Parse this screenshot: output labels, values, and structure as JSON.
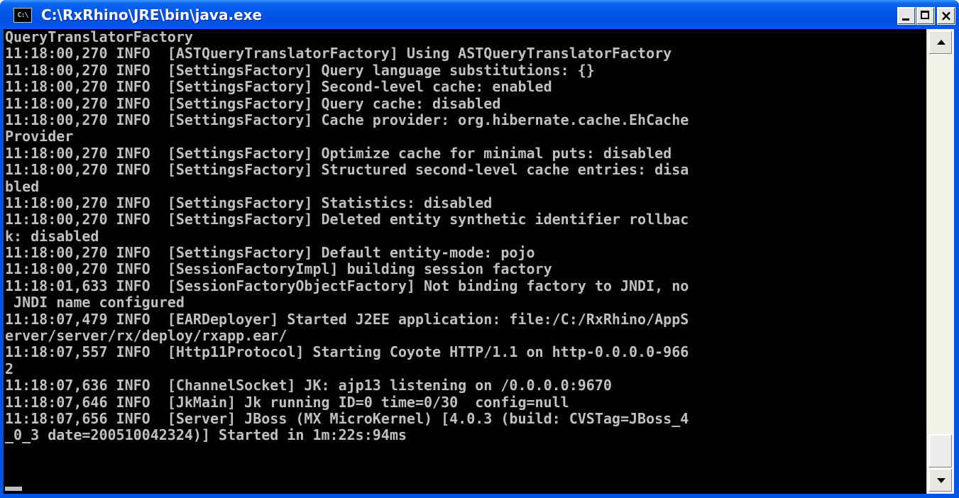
{
  "window": {
    "title": "C:\\RxRhino\\JRE\\bin\\java.exe",
    "icon_label": "C:\\",
    "icon": "console-icon",
    "accent_color": "#0054e3",
    "text_color": "#c0c0c0",
    "background_color": "#000000"
  },
  "controls": {
    "minimize_icon": "minimize-icon",
    "maximize_icon": "maximize-icon",
    "close_glyph": "×"
  },
  "console": {
    "lines": [
      "QueryTranslatorFactory",
      "11:18:00,270 INFO  [ASTQueryTranslatorFactory] Using ASTQueryTranslatorFactory",
      "11:18:00,270 INFO  [SettingsFactory] Query language substitutions: {}",
      "11:18:00,270 INFO  [SettingsFactory] Second-level cache: enabled",
      "11:18:00,270 INFO  [SettingsFactory] Query cache: disabled",
      "11:18:00,270 INFO  [SettingsFactory] Cache provider: org.hibernate.cache.EhCache",
      "Provider",
      "11:18:00,270 INFO  [SettingsFactory] Optimize cache for minimal puts: disabled",
      "11:18:00,270 INFO  [SettingsFactory] Structured second-level cache entries: disa",
      "bled",
      "11:18:00,270 INFO  [SettingsFactory] Statistics: disabled",
      "11:18:00,270 INFO  [SettingsFactory] Deleted entity synthetic identifier rollbac",
      "k: disabled",
      "11:18:00,270 INFO  [SettingsFactory] Default entity-mode: pojo",
      "11:18:00,270 INFO  [SessionFactoryImpl] building session factory",
      "11:18:01,633 INFO  [SessionFactoryObjectFactory] Not binding factory to JNDI, no",
      " JNDI name configured",
      "11:18:07,479 INFO  [EARDeployer] Started J2EE application: file:/C:/RxRhino/AppS",
      "erver/server/rx/deploy/rxapp.ear/",
      "11:18:07,557 INFO  [Http11Protocol] Starting Coyote HTTP/1.1 on http-0.0.0.0-966",
      "2",
      "11:18:07,636 INFO  [ChannelSocket] JK: ajp13 listening on /0.0.0.0:9670",
      "11:18:07,646 INFO  [JkMain] Jk running ID=0 time=0/30  config=null",
      "11:18:07,656 INFO  [Server] JBoss (MX MicroKernel) [4.0.3 (build: CVSTag=JBoss_4",
      "_0_3 date=200510042324)] Started in 1m:22s:94ms",
      ""
    ]
  },
  "scrollbar": {
    "up_icon": "scroll-up-arrow-icon",
    "down_icon": "scroll-down-arrow-icon",
    "position_fraction": 0.97
  }
}
